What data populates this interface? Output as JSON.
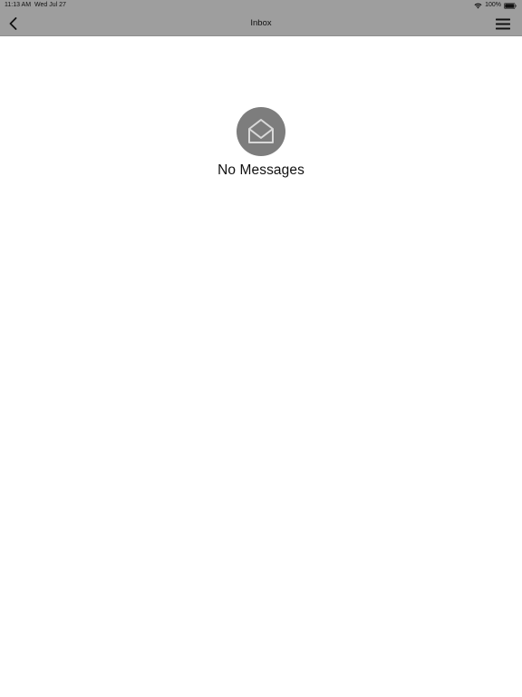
{
  "status_bar": {
    "time": "11:13 AM",
    "date": "Wed Jul 27",
    "battery_percent": "100%",
    "battery_level": 1.0,
    "wifi": "wifi-icon"
  },
  "nav": {
    "title": "Inbox",
    "back_icon": "chevron-left-icon",
    "menu_icon": "hamburger-menu-icon"
  },
  "empty_state": {
    "icon": "open-envelope-icon",
    "message": "No Messages"
  },
  "colors": {
    "bar_background": "#9e9e9e",
    "icon_circle": "#7d7d7d",
    "page_background": "#ffffff",
    "text": "#111111"
  }
}
